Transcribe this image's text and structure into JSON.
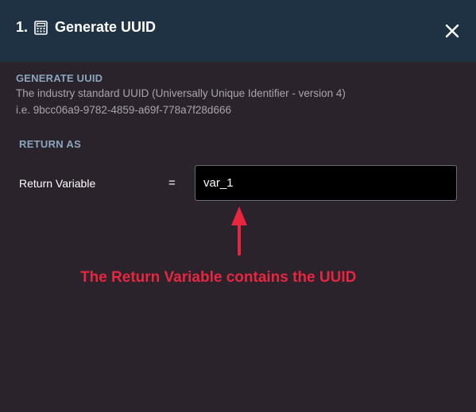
{
  "header": {
    "step_number": "1.",
    "title": "Generate UUID",
    "icon": "calculator-icon",
    "close_icon": "close-icon"
  },
  "description": {
    "section_title": "GENERATE UUID",
    "line_1": "The industry standard UUID (Universally Unique Identifier - version 4)",
    "line_2": "i.e. 9bcc06a9-9782-4859-a69f-778a7f28d666"
  },
  "return_section": {
    "title": "RETURN AS",
    "label": "Return Variable",
    "equals": "=",
    "value": "var_1"
  },
  "annotation": {
    "text": "The Return Variable contains the UUID",
    "color": "#e8263f"
  },
  "colors": {
    "header_bg": "#1e3244",
    "body_bg": "#2a232c",
    "section_title": "#8aa6bd",
    "accent_red": "#e8263f"
  }
}
